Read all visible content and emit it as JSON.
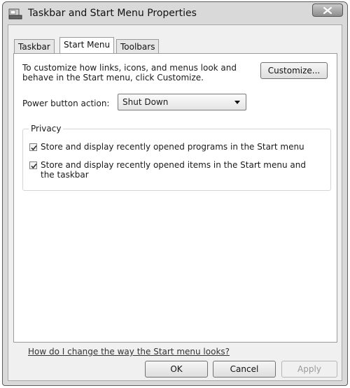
{
  "window": {
    "title": "Taskbar and Start Menu Properties"
  },
  "tabs": [
    {
      "label": "Taskbar",
      "active": false
    },
    {
      "label": "Start Menu",
      "active": true
    },
    {
      "label": "Toolbars",
      "active": false
    }
  ],
  "start_menu": {
    "instructions": "To customize how links, icons, and menus look and behave in the Start menu, click Customize.",
    "customize_label": "Customize...",
    "power_label": "Power button action:",
    "power_value": "Shut Down",
    "privacy_label": "Privacy",
    "privacy_items": [
      {
        "label": "Store and display recently opened programs in the Start menu",
        "checked": true
      },
      {
        "label": "Store and display recently opened items in the Start menu and the taskbar",
        "checked": true
      }
    ],
    "help_link": "How do I change the way the Start menu looks?"
  },
  "buttons": {
    "ok": "OK",
    "cancel": "Cancel",
    "apply": "Apply",
    "apply_enabled": false
  },
  "icons": {
    "app": "taskbar-icon",
    "close": "close-icon",
    "check": "check-icon"
  }
}
